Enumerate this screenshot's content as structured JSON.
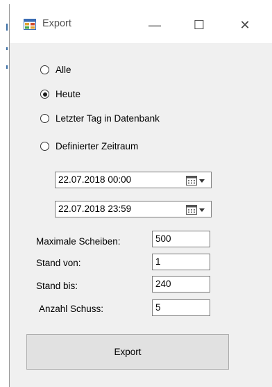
{
  "window": {
    "title": "Export",
    "icon": "app-form-icon",
    "minimize_glyph": "—",
    "maximize_glyph": "☐",
    "close_glyph": "✕"
  },
  "range_options": [
    {
      "label": "Alle",
      "checked": false
    },
    {
      "label": "Heute",
      "checked": true
    },
    {
      "label": "Letzter Tag in Datenbank",
      "checked": false
    },
    {
      "label": "Definierter Zeitraum",
      "checked": false
    }
  ],
  "date_from": {
    "value": "22.07.2018 00:00",
    "icon": "calendar-dropdown-icon"
  },
  "date_to": {
    "value": "22.07.2018 23:59",
    "icon": "calendar-dropdown-icon"
  },
  "fields": [
    {
      "label": "Maximale Scheiben:",
      "value": "500"
    },
    {
      "label": "Stand von:",
      "value": "1"
    },
    {
      "label": "Stand bis:",
      "value": "240"
    },
    {
      "label": "Anzahl Schuss:",
      "value": "5"
    }
  ],
  "export_button": {
    "label": "Export"
  },
  "colors": {
    "accent": "#3a6ea5",
    "form_bg": "#f0f0f0"
  }
}
